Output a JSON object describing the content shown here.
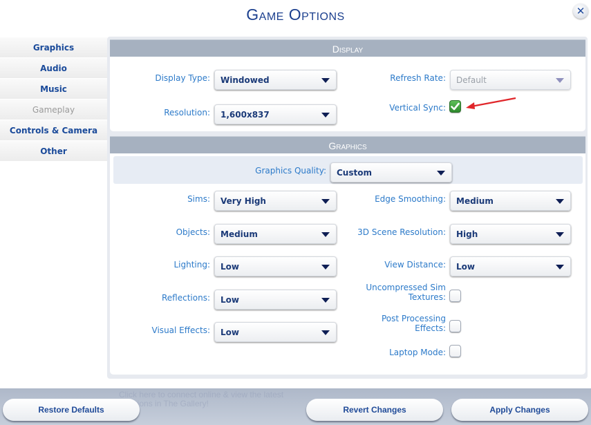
{
  "window": {
    "title": "Game Options",
    "close_icon": "close-icon"
  },
  "sidebar": {
    "items": [
      {
        "label": "Graphics",
        "enabled": true
      },
      {
        "label": "Audio",
        "enabled": true
      },
      {
        "label": "Music",
        "enabled": true
      },
      {
        "label": "Gameplay",
        "enabled": false
      },
      {
        "label": "Controls & Camera",
        "enabled": true
      },
      {
        "label": "Other",
        "enabled": true
      }
    ]
  },
  "display": {
    "header": "Display",
    "display_type": {
      "label": "Display Type:",
      "value": "Windowed"
    },
    "resolution": {
      "label": "Resolution:",
      "value": "1,600x837"
    },
    "refresh_rate": {
      "label": "Refresh Rate:",
      "value": "Default",
      "enabled": false
    },
    "vertical_sync": {
      "label": "Vertical Sync:",
      "checked": true
    }
  },
  "graphics": {
    "header": "Graphics",
    "quality": {
      "label": "Graphics Quality:",
      "value": "Custom"
    },
    "sims": {
      "label": "Sims:",
      "value": "Very High"
    },
    "objects": {
      "label": "Objects:",
      "value": "Medium"
    },
    "lighting": {
      "label": "Lighting:",
      "value": "Low"
    },
    "reflections": {
      "label": "Reflections:",
      "value": "Low"
    },
    "visual_effects": {
      "label": "Visual Effects:",
      "value": "Low"
    },
    "edge_smoothing": {
      "label": "Edge Smoothing:",
      "value": "Medium"
    },
    "scene_resolution": {
      "label": "3D Scene Resolution:",
      "value": "High"
    },
    "view_distance": {
      "label": "View Distance:",
      "value": "Low"
    },
    "uncompressed_textures": {
      "label_line1": "Uncompressed Sim",
      "label_line2": "Textures:",
      "checked": false
    },
    "post_processing": {
      "label_line1": "Post Processing",
      "label_line2": "Effects:",
      "checked": false
    },
    "laptop_mode": {
      "label": "Laptop Mode:",
      "checked": false
    }
  },
  "annotation": {
    "arrow_color": "#e0262a",
    "target": "vertical_sync"
  },
  "footer": {
    "background_text": "Click here to connect online & view the latest creations in The Gallery!",
    "restore_defaults": "Restore Defaults",
    "revert_changes": "Revert Changes",
    "apply_changes": "Apply Changes"
  },
  "colors": {
    "title": "#1b3f8e",
    "label": "#2c7ac9",
    "value": "#1b3a78",
    "section_header": "#a6b1c0",
    "checkbox_checked": "#3aa23a"
  }
}
